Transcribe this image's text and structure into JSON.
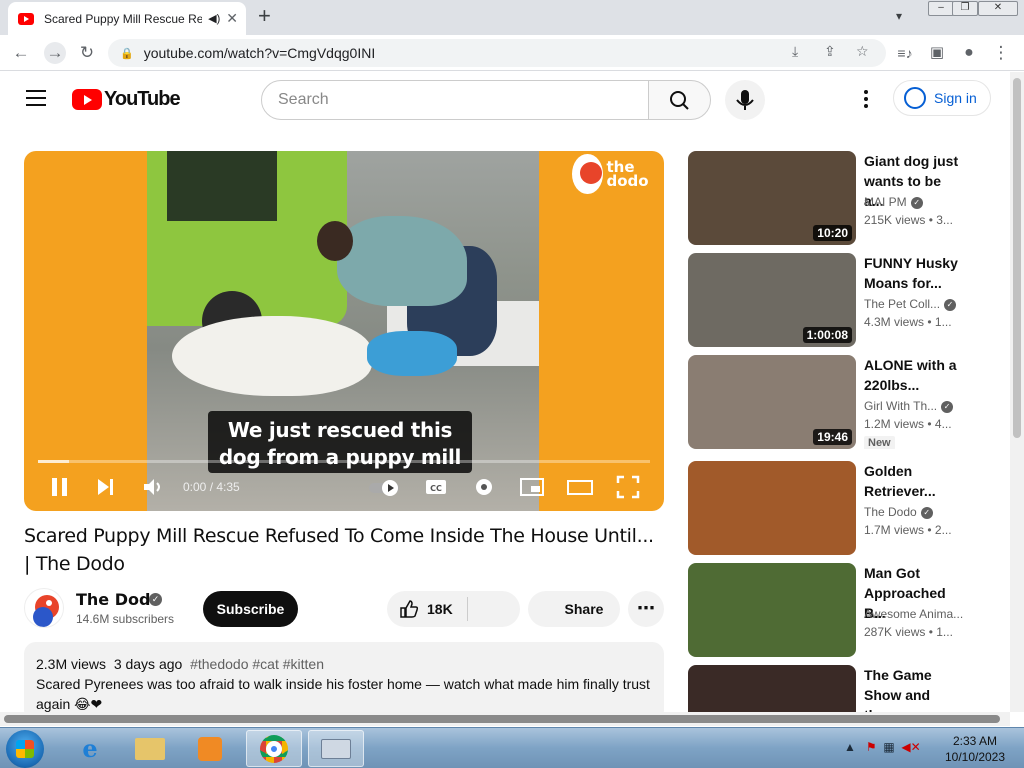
{
  "browser": {
    "tab_title": "Scared Puppy Mill Rescue Re",
    "url": "youtube.com/watch?v=CmgVdqg0INI"
  },
  "youtube": {
    "logo_text": "YouTube",
    "search_placeholder": "Search",
    "sign_in": "Sign in"
  },
  "player": {
    "caption_line1": "We just rescued this",
    "caption_line2": "dog from a puppy mill",
    "time": "0:00 / 4:35",
    "progress": 0.0,
    "watermark": "the dodo"
  },
  "video": {
    "title": "Scared Puppy Mill Rescue Refused To Come Inside The House Until... | The Dodo",
    "channel": "The Dodo",
    "subscribers": "14.6M subscribers",
    "subscribe_label": "Subscribe",
    "likes": "18K",
    "share_label": "Share",
    "views": "2.3M views",
    "age": "3 days ago",
    "tags": "#thedodo #cat #kitten",
    "description": "Scared Pyrenees was too afraid to walk inside his foster home — watch what made him finally trust again 😂❤"
  },
  "recommendations": [
    {
      "title_l1": "Giant dog just",
      "title_l2": "wants to be a...",
      "channel": "MAI PM",
      "verified": true,
      "views": "215K views",
      "age": "• 3...",
      "duration": "10:20",
      "thumb_color": "#5b4a3a"
    },
    {
      "title_l1": "FUNNY Husky",
      "title_l2": "Moans for...",
      "channel": "The Pet Coll...",
      "verified": true,
      "views": "4.3M views",
      "age": "• 1...",
      "duration": "1:00:08",
      "thumb_color": "#6e6a62"
    },
    {
      "title_l1": "ALONE with a",
      "title_l2": "220lbs...",
      "channel": "Girl With Th...",
      "verified": true,
      "views": "1.2M views",
      "age": "• 4...",
      "duration": "19:46",
      "badge": "New",
      "thumb_color": "#8a7d72"
    },
    {
      "title_l1": "Golden",
      "title_l2": "Retriever...",
      "channel": "The Dodo",
      "verified": true,
      "views": "1.7M views",
      "age": "• 2...",
      "duration": "",
      "thumb_color": "#a15a2a"
    },
    {
      "title_l1": "Man Got",
      "title_l2": "Approached B...",
      "channel": "Awesome Anima...",
      "verified": false,
      "views": "287K views",
      "age": "• 1...",
      "duration": "",
      "thumb_color": "#4f6b34"
    },
    {
      "title_l1": "The Game",
      "title_l2": "Show and the...",
      "channel": "",
      "verified": false,
      "views": "",
      "age": "",
      "duration": "",
      "thumb_color": "#3a2a26"
    }
  ],
  "taskbar": {
    "time": "2:33 AM",
    "date": "10/10/2023"
  }
}
